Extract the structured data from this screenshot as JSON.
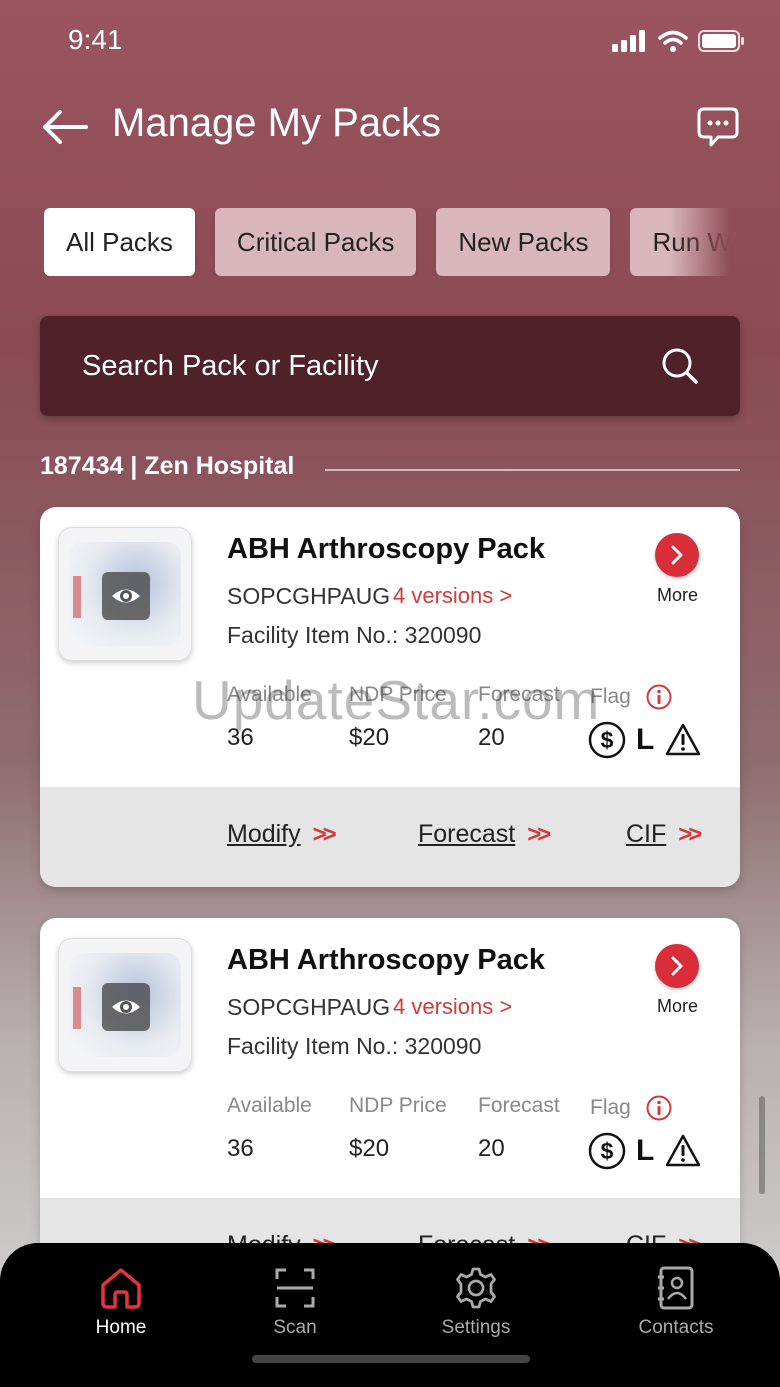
{
  "status_bar": {
    "time": "9:41"
  },
  "header": {
    "title": "Manage My Packs"
  },
  "tabs": [
    {
      "label": "All Packs",
      "active": true
    },
    {
      "label": "Critical Packs",
      "active": false
    },
    {
      "label": "New Packs",
      "active": false
    },
    {
      "label": "Run W",
      "active": false
    }
  ],
  "search": {
    "placeholder": "Search Pack or Facility"
  },
  "facility": {
    "label": "187434 | Zen Hospital"
  },
  "cards": [
    {
      "name": "ABH Arthroscopy Pack",
      "code": "SOPCGHPAUG",
      "versions": "4 versions >",
      "item_no": "Facility Item No.: 320090",
      "more_label": "More",
      "stats": [
        {
          "label": "Available",
          "value": "36"
        },
        {
          "label": "NDP Price",
          "value": "$20"
        },
        {
          "label": "Forecast",
          "value": "20"
        }
      ],
      "flag_label": "Flag",
      "flag_letter": "L",
      "actions": [
        "Modify",
        "Forecast",
        "CIF"
      ]
    },
    {
      "name": "ABH Arthroscopy Pack",
      "code": "SOPCGHPAUG",
      "versions": "4 versions >",
      "item_no": "Facility Item No.: 320090",
      "more_label": "More",
      "stats": [
        {
          "label": "Available",
          "value": "36"
        },
        {
          "label": "NDP Price",
          "value": "$20"
        },
        {
          "label": "Forecast",
          "value": "20"
        }
      ],
      "flag_label": "Flag",
      "flag_letter": "L",
      "actions": [
        "Modify",
        "Forecast",
        "CIF"
      ]
    }
  ],
  "watermark": "UpdateStar.com",
  "nav": [
    {
      "label": "Home",
      "icon": "home-icon",
      "active": true
    },
    {
      "label": "Scan",
      "icon": "scan-icon",
      "active": false
    },
    {
      "label": "Settings",
      "icon": "gear-icon",
      "active": false
    },
    {
      "label": "Contacts",
      "icon": "contacts-icon",
      "active": false
    }
  ],
  "colors": {
    "accent": "#d92e3a",
    "search_bg": "#4e2228",
    "nav_bg": "#000000"
  }
}
